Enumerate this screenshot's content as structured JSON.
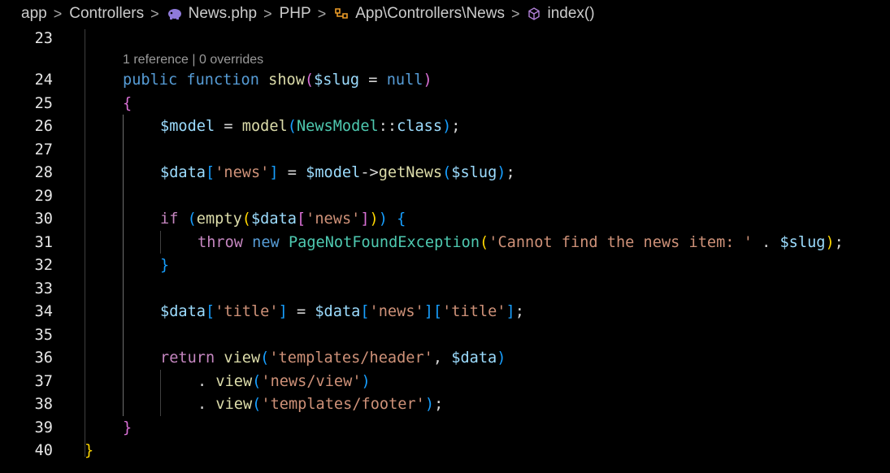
{
  "breadcrumb": {
    "items": [
      "app",
      "Controllers",
      "News.php",
      "PHP",
      "App\\Controllers\\News",
      "index()"
    ],
    "separator": ">"
  },
  "editor": {
    "codelens": "1 reference | 0 overrides",
    "line_numbers": [
      "23",
      "24",
      "25",
      "26",
      "27",
      "28",
      "29",
      "30",
      "31",
      "32",
      "33",
      "34",
      "35",
      "36",
      "37",
      "38",
      "39",
      "40"
    ],
    "lines": {
      "l24": [
        [
          "kw",
          "public "
        ],
        [
          "kw",
          "function "
        ],
        [
          "fn",
          "show"
        ],
        [
          "b2",
          "("
        ],
        [
          "var",
          "$slug"
        ],
        [
          "plain",
          " = "
        ],
        [
          "kw",
          "null"
        ],
        [
          "b2",
          ")"
        ]
      ],
      "l25": [
        [
          "b2",
          "{"
        ]
      ],
      "l26": [
        [
          "var",
          "$model"
        ],
        [
          "plain",
          " = "
        ],
        [
          "fn",
          "model"
        ],
        [
          "b3",
          "("
        ],
        [
          "cls",
          "NewsModel"
        ],
        [
          "plain",
          "::"
        ],
        [
          "var",
          "class"
        ],
        [
          "b3",
          ")"
        ],
        [
          "plain",
          ";"
        ]
      ],
      "l28": [
        [
          "var",
          "$data"
        ],
        [
          "b3",
          "["
        ],
        [
          "str",
          "'news'"
        ],
        [
          "b3",
          "]"
        ],
        [
          "plain",
          " = "
        ],
        [
          "var",
          "$model"
        ],
        [
          "plain",
          "->"
        ],
        [
          "fn",
          "getNews"
        ],
        [
          "b3",
          "("
        ],
        [
          "var",
          "$slug"
        ],
        [
          "b3",
          ")"
        ],
        [
          "plain",
          ";"
        ]
      ],
      "l30": [
        [
          "ctrl",
          "if "
        ],
        [
          "b3",
          "("
        ],
        [
          "fn",
          "empty"
        ],
        [
          "b1",
          "("
        ],
        [
          "var",
          "$data"
        ],
        [
          "b2",
          "["
        ],
        [
          "str",
          "'news'"
        ],
        [
          "b2",
          "]"
        ],
        [
          "b1",
          ")"
        ],
        [
          "b3",
          ")"
        ],
        [
          "plain",
          " "
        ],
        [
          "b3",
          "{"
        ]
      ],
      "l31": [
        [
          "ctrl",
          "throw "
        ],
        [
          "kw",
          "new "
        ],
        [
          "cls",
          "PageNotFoundException"
        ],
        [
          "b1",
          "("
        ],
        [
          "str",
          "'Cannot find the news item: '"
        ],
        [
          "plain",
          " . "
        ],
        [
          "var",
          "$slug"
        ],
        [
          "b1",
          ")"
        ],
        [
          "plain",
          ";"
        ]
      ],
      "l32": [
        [
          "b3",
          "}"
        ]
      ],
      "l34": [
        [
          "var",
          "$data"
        ],
        [
          "b3",
          "["
        ],
        [
          "str",
          "'title'"
        ],
        [
          "b3",
          "]"
        ],
        [
          "plain",
          " = "
        ],
        [
          "var",
          "$data"
        ],
        [
          "b3",
          "["
        ],
        [
          "str",
          "'news'"
        ],
        [
          "b3",
          "]["
        ],
        [
          "str",
          "'title'"
        ],
        [
          "b3",
          "]"
        ],
        [
          "plain",
          ";"
        ]
      ],
      "l36": [
        [
          "ctrl",
          "return "
        ],
        [
          "fn",
          "view"
        ],
        [
          "b3",
          "("
        ],
        [
          "str",
          "'templates/header'"
        ],
        [
          "plain",
          ", "
        ],
        [
          "var",
          "$data"
        ],
        [
          "b3",
          ")"
        ]
      ],
      "l37": [
        [
          "plain",
          ". "
        ],
        [
          "fn",
          "view"
        ],
        [
          "b3",
          "("
        ],
        [
          "str",
          "'news/view'"
        ],
        [
          "b3",
          ")"
        ]
      ],
      "l38": [
        [
          "plain",
          ". "
        ],
        [
          "fn",
          "view"
        ],
        [
          "b3",
          "("
        ],
        [
          "str",
          "'templates/footer'"
        ],
        [
          "b3",
          ")"
        ],
        [
          "plain",
          ";"
        ]
      ],
      "l39": [
        [
          "b2",
          "}"
        ]
      ],
      "l40": [
        [
          "b1",
          "}"
        ]
      ]
    }
  },
  "colors": {
    "background": "#000000",
    "keyword": "#569cd6",
    "control": "#c586c0",
    "function": "#dcdcaa",
    "variable": "#9cdcfe",
    "string": "#ce9178",
    "class": "#4ec9b0",
    "bracket_gold": "#ffd700",
    "bracket_orchid": "#da70d6",
    "bracket_blue": "#179fff"
  },
  "icons": {
    "php_file": "elephant-icon",
    "namespace": "class-icon",
    "method": "method-cube-icon"
  }
}
